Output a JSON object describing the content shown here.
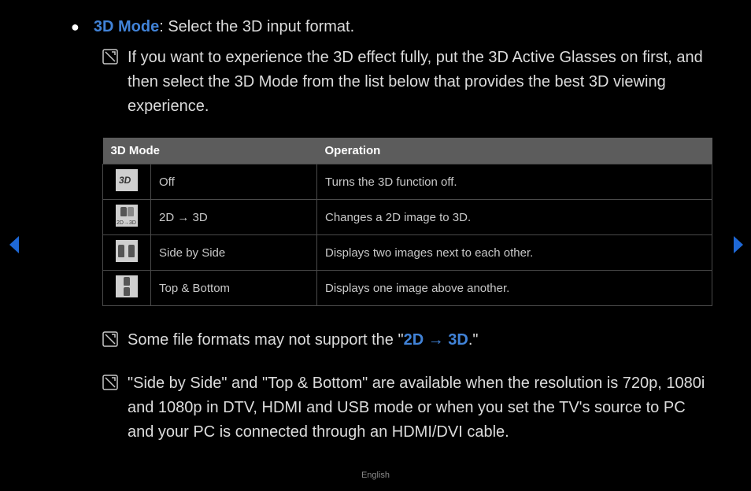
{
  "main": {
    "heading_keyword": "3D Mode",
    "heading_rest": ": Select the 3D input format.",
    "intro_note": "If you want to experience the 3D effect fully, put the 3D Active Glasses on first, and then select the 3D Mode from the list below that provides the best 3D viewing experience."
  },
  "table": {
    "header_mode": "3D Mode",
    "header_op": "Operation",
    "rows": [
      {
        "icon": "off",
        "mode": "Off",
        "op": "Turns the 3D function off."
      },
      {
        "icon": "2d3d",
        "mode": "2D → 3D",
        "op": "Changes a 2D image to 3D."
      },
      {
        "icon": "sbs",
        "mode": "Side by Side",
        "op": "Displays two images next to each other."
      },
      {
        "icon": "tb",
        "mode": "Top & Bottom",
        "op": "Displays one image above another."
      }
    ]
  },
  "notes": {
    "n1_pre": "Some file formats may not support the \"",
    "n1_kw": "2D → 3D",
    "n1_post": ".\"",
    "n2": "\"Side by Side\" and \"Top & Bottom\" are available when the resolution is 720p, 1080i and 1080p in DTV, HDMI and USB mode or when you set the TV's source to PC and your PC is connected through an HDMI/DVI cable."
  },
  "footer": "English"
}
